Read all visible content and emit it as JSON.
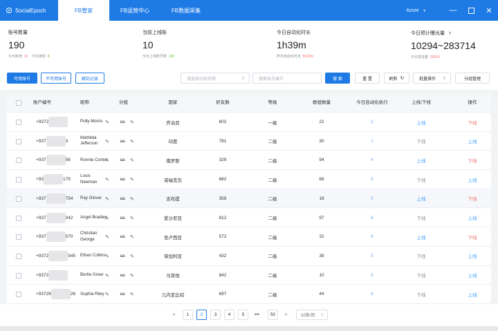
{
  "app": {
    "brand": "SocialEpoch",
    "tabs": [
      "FB管家",
      "FB运营中心",
      "FB数据采集"
    ],
    "user": "Azure",
    "window_buttons": [
      "minimize-icon",
      "maximize-icon",
      "close-icon"
    ]
  },
  "stats": [
    {
      "label": "账号数量",
      "value": "190",
      "sub1_label": "今日新增",
      "sub1_value": "10",
      "sub2_label": "今日被封",
      "sub2_value": "8"
    },
    {
      "label": "当前上线账",
      "value": "10",
      "sub1_label": "今日上线账号数",
      "sub1_value": "100"
    },
    {
      "label": "今日自动化时长",
      "value": "1h39m",
      "sub1_label": "昨日自动化时长",
      "sub1_value": "8h23m"
    },
    {
      "label": "今日预计曝光量",
      "value": "10294~283714",
      "sub1_label": "今日发送量",
      "sub1_value": "29314"
    }
  ],
  "toolbar": {
    "tabs": [
      "可用账号",
      "不可用账号",
      "解封记录"
    ],
    "group_placeholder": "请选择分组名称",
    "search_placeholder": "搜索账号编号",
    "search": "搜 索",
    "reset": "重 置",
    "refresh": "刷新",
    "batch": "批量操作",
    "group_manage": "分组管理"
  },
  "table": {
    "headers": [
      "账户编号",
      "昵称",
      "分组",
      "国家",
      "好友数",
      "等级",
      "群组数量",
      "今日自动化执行",
      "上线/下线",
      "操作"
    ],
    "rows": [
      {
        "acct_a": "+9372",
        "acct_b": "",
        "nick": "Polly Morris",
        "group": "aa",
        "country": "乔治亚",
        "friends": "602",
        "level": "一级",
        "groups": "22",
        "auto": "2",
        "status": "上线",
        "op": "下线"
      },
      {
        "acct_a": "+937",
        "acct_b": "3",
        "nick": "Mathilda Jefferson",
        "group": "aa",
        "country": "印度",
        "friends": "781",
        "level": "二级",
        "groups": "30",
        "auto": "1",
        "status": "下线",
        "op": "上线"
      },
      {
        "acct_a": "+937",
        "acct_b": "56",
        "nick": "Ronnie Cortez",
        "group": "aa",
        "country": "俄罗斯",
        "friends": "329",
        "level": "二级",
        "groups": "94",
        "auto": "4",
        "status": "上线",
        "op": "下线"
      },
      {
        "acct_a": "+93",
        "acct_b": "179",
        "nick": "Louis Newman",
        "group": "aa",
        "country": "诺福克岛",
        "friends": "682",
        "level": "二级",
        "groups": "68",
        "auto": "5",
        "status": "下线",
        "op": "上线"
      },
      {
        "acct_a": "+937",
        "acct_b": "754",
        "nick": "Ray Glover",
        "group": "aa",
        "country": "吉布提",
        "friends": "359",
        "level": "二级",
        "groups": "18",
        "auto": "5",
        "status": "上线",
        "op": "下线"
      },
      {
        "acct_a": "+937",
        "acct_b": "042",
        "nick": "Angel Bradley",
        "group": "aa",
        "country": "爱沙尼亚",
        "friends": "812",
        "level": "二级",
        "groups": "97",
        "auto": "6",
        "status": "下线",
        "op": "上线"
      },
      {
        "acct_a": "+937",
        "acct_b": "570",
        "nick": "Christian George",
        "group": "aa",
        "country": "圣卢西亚",
        "friends": "572",
        "level": "二级",
        "groups": "32",
        "auto": "6",
        "status": "上线",
        "op": "下线"
      },
      {
        "acct_a": "+9372",
        "acct_b": "545",
        "nick": "Ethan Collins",
        "group": "aa",
        "country": "保加利亚",
        "friends": "432",
        "level": "二级",
        "groups": "39",
        "auto": "5",
        "status": "下线",
        "op": "上线"
      },
      {
        "acct_a": "+9372",
        "acct_b": "",
        "nick": "Bertie Greer",
        "group": "aa",
        "country": "马耳他",
        "friends": "842",
        "level": "二级",
        "groups": "10",
        "auto": "5",
        "status": "下线",
        "op": "上线"
      },
      {
        "acct_a": "+93728",
        "acct_b": "26",
        "nick": "Sophia Riley",
        "group": "aa",
        "country": "几内亚比绍",
        "friends": "697",
        "level": "二级",
        "groups": "44",
        "auto": "6",
        "status": "下线",
        "op": "上线"
      }
    ]
  },
  "pager": {
    "prev": "<",
    "pages": [
      "1",
      "2",
      "3",
      "4",
      "5",
      "•••",
      "50"
    ],
    "active": "2",
    "next": ">",
    "page_size": "10条/页"
  }
}
